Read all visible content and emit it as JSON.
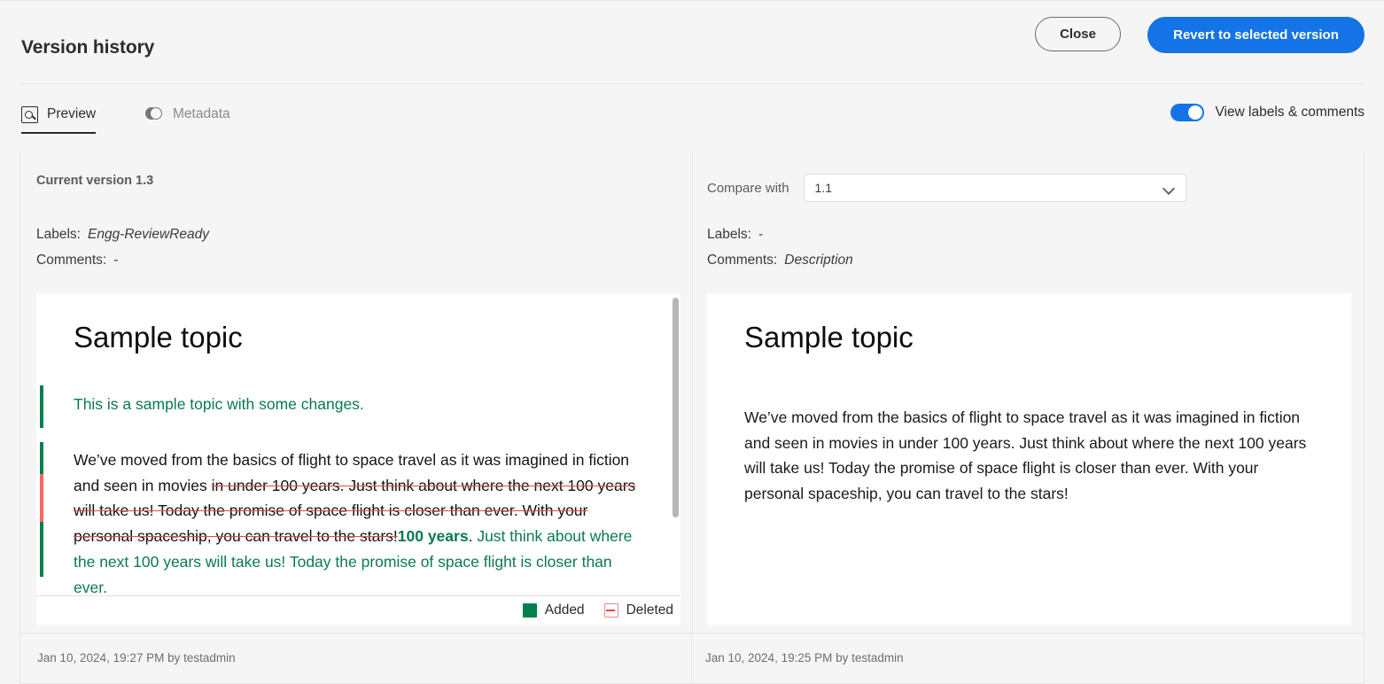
{
  "header": {
    "title": "Version history",
    "close_label": "Close",
    "revert_label": "Revert to selected version"
  },
  "tabs": [
    {
      "id": "preview",
      "label": "Preview",
      "icon": "preview-icon",
      "active": true
    },
    {
      "id": "metadata",
      "label": "Metadata",
      "icon": "metadata-icon",
      "active": false
    }
  ],
  "toggle": {
    "label": "View labels & comments",
    "state": "on",
    "accent": "#1473e6"
  },
  "left_panel": {
    "current_version_label": "Current version 1.3",
    "labels_key": "Labels:",
    "labels_value": "Engg-ReviewReady",
    "comments_key": "Comments:",
    "comments_value": "-",
    "doc_title": "Sample topic",
    "added_heading": "This is a sample topic with some changes.",
    "body_segments": [
      {
        "type": "unchanged",
        "text": "We’ve moved from the basics of flight to space travel as it was imagined in fiction and seen in movies "
      },
      {
        "type": "deleted",
        "text": "in under 100 years. Just think about where the next 100 years will take us! Today the promise of space flight is closer than ever. With your personal spaceship, you can travel to the stars!"
      },
      {
        "type": "added-bold",
        "text": "100 years"
      },
      {
        "type": "unchanged",
        "text": "."
      },
      {
        "type": "added",
        "text": " Just think about where the next 100 years will take us! Today the promise of space flight is closer than ever."
      }
    ],
    "timestamp": "Jan 10, 2024, 19:27 PM by testadmin"
  },
  "right_panel": {
    "compare_with_label": "Compare with",
    "compare_with_value": "1.1",
    "labels_key": "Labels:",
    "labels_value": "-",
    "comments_key": "Comments:",
    "comments_value": "Description",
    "doc_title": "Sample topic",
    "body": "We’ve moved from the basics of flight to space travel as it was imagined in fiction and seen in movies in under 100 years. Just think about where the next 100 years will take us! Today the promise of space flight is closer than ever. With your personal spaceship, you can travel to the stars!",
    "timestamp": "Jan 10, 2024, 19:25 PM by testadmin"
  },
  "legend": {
    "added_label": "Added",
    "deleted_label": "Deleted",
    "added_color": "#00804d",
    "deleted_color": "#e8483f"
  }
}
